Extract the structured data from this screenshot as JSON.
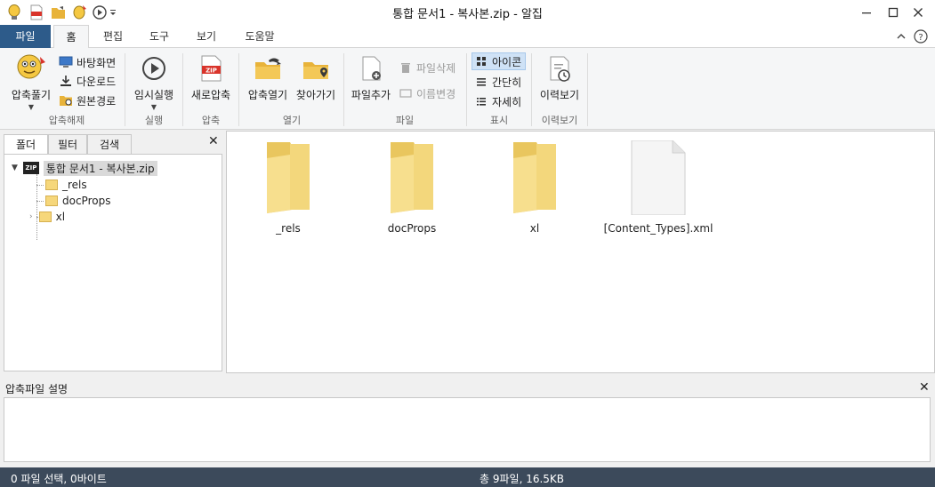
{
  "window": {
    "title": "통합 문서1 - 복사본.zip - 알집",
    "controls": [
      "minimize",
      "maximize",
      "close"
    ]
  },
  "quick_access": {
    "icons": [
      "app-logo-icon",
      "new-zip-icon",
      "open-folder-icon",
      "extract-icon",
      "run-icon",
      "customize-dropdown-icon"
    ]
  },
  "ribbon_tabs": [
    {
      "label": "파일"
    },
    {
      "label": "홈"
    },
    {
      "label": "편집"
    },
    {
      "label": "도구"
    },
    {
      "label": "보기"
    },
    {
      "label": "도움말"
    }
  ],
  "active_tab": "홈",
  "ribbon": {
    "groups": {
      "extract": {
        "label": "압축해제",
        "big_button": "압축풀기",
        "small_buttons": [
          "바탕화면",
          "다운로드",
          "원본경로"
        ]
      },
      "run": {
        "label": "실행",
        "big_button": "임시실행"
      },
      "compress": {
        "label": "압축",
        "big_button": "새로압축"
      },
      "open": {
        "label": "열기",
        "buttons": [
          "압축열기",
          "찾아가기"
        ]
      },
      "file": {
        "label": "파일",
        "big_button": "파일추가",
        "small_buttons": [
          "파일삭제",
          "이름변경"
        ]
      },
      "view": {
        "label": "표시",
        "small_buttons": [
          "아이콘",
          "간단히",
          "자세히"
        ],
        "selected": "아이콘"
      },
      "history": {
        "label": "이력보기",
        "big_button": "이력보기"
      }
    }
  },
  "left_panel": {
    "tabs": [
      "폴더",
      "필터",
      "검색"
    ],
    "active_tab": "폴더",
    "tree": {
      "root": "통합 문서1 - 복사본.zip",
      "children": [
        "_rels",
        "docProps",
        "xl"
      ]
    }
  },
  "files": [
    {
      "name": "_rels",
      "type": "folder"
    },
    {
      "name": "docProps",
      "type": "folder"
    },
    {
      "name": "xl",
      "type": "folder"
    },
    {
      "name": "[Content_Types].xml",
      "type": "file"
    }
  ],
  "description_panel": {
    "title": "압축파일 설명",
    "content": ""
  },
  "status_bar": {
    "selection": "0 파일 선택,  0바이트",
    "total": "총 9파일,  16.5KB"
  },
  "colors": {
    "file_tab": "#2d5b8a",
    "status_bar": "#3c4a5b",
    "folder": "#f6d77b",
    "selected_view": "#cfe2f6"
  }
}
